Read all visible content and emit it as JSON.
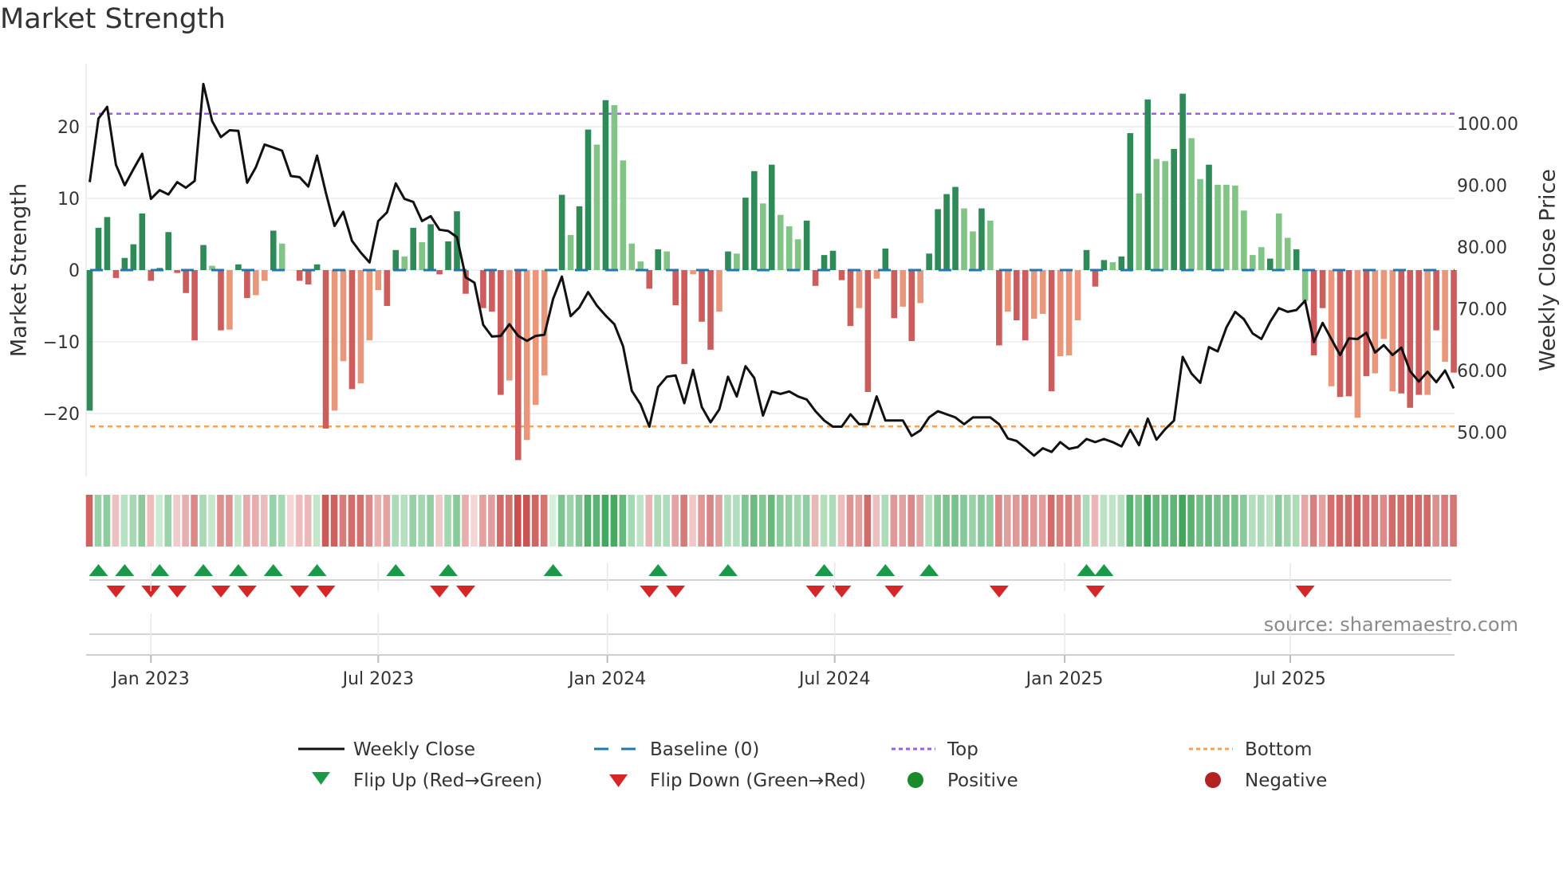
{
  "title": "Market Strength",
  "source": "source: sharemaestro.com",
  "legend": {
    "weekly_close": "Weekly Close",
    "baseline": "Baseline (0)",
    "top": "Top",
    "bottom": "Bottom",
    "flip_up": "Flip Up (Red→Green)",
    "flip_down": "Flip Down (Green→Red)",
    "positive": "Positive",
    "negative": "Negative"
  },
  "colors": {
    "strong_pos": "#2e8b57",
    "weak_pos": "#82c485",
    "strong_neg": "#cd5c5c",
    "weak_neg": "#e9967a",
    "baseline": "#1f77b4",
    "top": "#9b5de5",
    "bottom": "#f4a259",
    "price": "#111111",
    "flip_up": "#1a9a48",
    "flip_down": "#d62728",
    "positive": "#1a8a2a",
    "negative": "#b22222"
  },
  "chart_data": {
    "type": "bar+line",
    "title": "Market Strength",
    "ylabel": "Market Strength",
    "y2label": "Weekly Close Price",
    "ylim": [
      -29,
      29
    ],
    "y2lim": [
      43,
      109
    ],
    "yticks": [
      "20",
      "10",
      "0",
      "−10",
      "−20"
    ],
    "yticks_values": [
      20,
      10,
      0,
      -10,
      -20
    ],
    "y2ticks": [
      "100.00",
      "90.00",
      "80.00",
      "70.00",
      "60.00",
      "50.00"
    ],
    "y2ticks_values": [
      100,
      90,
      80,
      70,
      60,
      50
    ],
    "xticks": [
      "Jan 2023",
      "Jul 2023",
      "Jan 2024",
      "Jul 2024",
      "Jan 2025",
      "Jul 2025"
    ],
    "xticks_week_index": [
      7,
      33,
      59.2,
      85.2,
      111.5,
      137.3
    ],
    "top_level": 21.8,
    "bottom_level": -21.8,
    "baseline": 0,
    "legend_position": "bottom",
    "strength": [
      -19.6,
      5.9,
      7.4,
      -1.1,
      1.7,
      3.6,
      7.9,
      -1.5,
      0.3,
      5.3,
      -0.4,
      -3.2,
      -9.8,
      3.5,
      0.6,
      -8.4,
      -8.3,
      0.8,
      -3.9,
      -3.5,
      -1.5,
      5.5,
      3.7,
      0,
      -1.5,
      -2.0,
      0.8,
      -22.1,
      -19.6,
      -12.7,
      -16.6,
      -15.8,
      -9.8,
      -2.8,
      -5.0,
      2.8,
      1.9,
      5.9,
      3.9,
      6.4,
      -0.6,
      4.0,
      8.2,
      -3.3,
      0,
      -5.3,
      -5.8,
      -17.4,
      -15.4,
      -26.5,
      -23.7,
      -18.8,
      -14.7,
      0,
      10.5,
      4.9,
      8.9,
      19.6,
      17.5,
      23.7,
      23.0,
      15.3,
      3.7,
      1.2,
      -2.6,
      2.9,
      2.6,
      -4.9,
      -13.1,
      -0.6,
      -7.2,
      -11.1,
      -5.8,
      2.6,
      2.3,
      10.1,
      13.8,
      9.3,
      14.7,
      7.7,
      6.1,
      4.3,
      6.9,
      -2.2,
      2.1,
      2.7,
      -1.4,
      -7.8,
      -5.3,
      -17.0,
      -1.2,
      3.0,
      -6.7,
      -5.1,
      -9.9,
      -4.6,
      2.3,
      8.5,
      10.6,
      11.6,
      8.6,
      5.4,
      8.6,
      6.9,
      -10.5,
      -5.8,
      -7.0,
      -9.8,
      -6.8,
      -6.1,
      -16.9,
      -12.0,
      -11.9,
      -7.0,
      2.8,
      -2.3,
      1.4,
      1.1,
      1.9,
      19.1,
      10.7,
      23.8,
      15.5,
      15.2,
      16.9,
      24.6,
      18.4,
      12.7,
      14.7,
      11.9,
      11.9,
      11.8,
      8.3,
      2.1,
      3.2,
      1.6,
      7.9,
      4.5,
      2.9,
      -4.3,
      -11.9,
      -5.3,
      -16.2,
      -17.7,
      -17.6,
      -20.6,
      -14.8,
      -14.4,
      -9.6,
      -16.9,
      -17.2,
      -19.2,
      -17.4,
      -17.4,
      -8.4,
      -12.8,
      -14.3
    ],
    "strength_shade": "GGGRGGGRGGRRRGgRrGRrrGg-RRGRrrRrrrRGgGgGRGGR-RRRrRrrr-GgGGgGggggRGgRRrRRrGgGGgGgggGRGGRRrRrGRrRrGGGGggGgRrRRrrRrrrGRGgGGgGggGGggGggggggGggGgRRrRRrRrrrRRRrRrRR",
    "weekly_close": [
      90.5,
      100.8,
      102.7,
      93.3,
      90.0,
      92.6,
      95.1,
      87.8,
      89.2,
      88.5,
      90.5,
      89.6,
      90.7,
      106.4,
      100.4,
      97.8,
      98.9,
      98.8,
      90.4,
      92.9,
      96.6,
      96.1,
      95.6,
      91.5,
      91.3,
      89.8,
      94.8,
      88.8,
      83.4,
      85.7,
      81.0,
      79.1,
      77.5,
      84.2,
      85.6,
      90.3,
      87.8,
      87.3,
      84.2,
      85.0,
      82.8,
      82.6,
      81.6,
      75.1,
      74.2,
      67.4,
      65.5,
      65.6,
      67.5,
      65.6,
      64.8,
      65.6,
      65.8,
      71.6,
      75.2,
      68.8,
      70.2,
      72.7,
      70.5,
      68.9,
      67.5,
      63.9,
      56.7,
      54.5,
      50.9,
      57.3,
      59.0,
      59.2,
      54.7,
      60.1,
      54.1,
      51.6,
      53.7,
      59.0,
      55.8,
      60.7,
      58.8,
      52.7,
      56.6,
      56.2,
      56.6,
      55.8,
      55.3,
      53.4,
      51.9,
      50.9,
      50.9,
      52.9,
      51.3,
      51.3,
      55.8,
      51.9,
      51.9,
      51.9,
      49.4,
      50.3,
      52.4,
      53.4,
      52.9,
      52.4,
      51.3,
      52.4,
      52.4,
      52.4,
      51.3,
      49.0,
      48.6,
      47.4,
      46.2,
      47.4,
      46.8,
      48.4,
      47.3,
      47.6,
      48.9,
      48.4,
      48.9,
      48.4,
      47.7,
      50.4,
      47.9,
      52.2,
      48.8,
      50.5,
      51.9,
      62.2,
      59.5,
      58.0,
      63.8,
      63.1,
      67.0,
      69.5,
      68.3,
      66.0,
      65.1,
      67.9,
      70.1,
      69.5,
      69.8,
      71.3,
      64.6,
      67.7,
      65.1,
      62.5,
      65.2,
      65.1,
      66.1,
      62.9,
      64.1,
      62.5,
      63.7,
      59.9,
      58.2,
      59.8,
      58.1,
      60.0,
      57.1
    ],
    "flip_up_weeks": [
      1,
      4,
      8,
      13,
      17,
      21,
      26,
      35,
      41,
      53,
      65,
      73,
      84,
      91,
      96,
      114,
      116
    ],
    "flip_down_weeks": [
      3,
      7,
      10,
      15,
      18,
      24,
      27,
      40,
      43,
      64,
      67,
      83,
      86,
      92,
      104,
      115,
      139
    ]
  }
}
